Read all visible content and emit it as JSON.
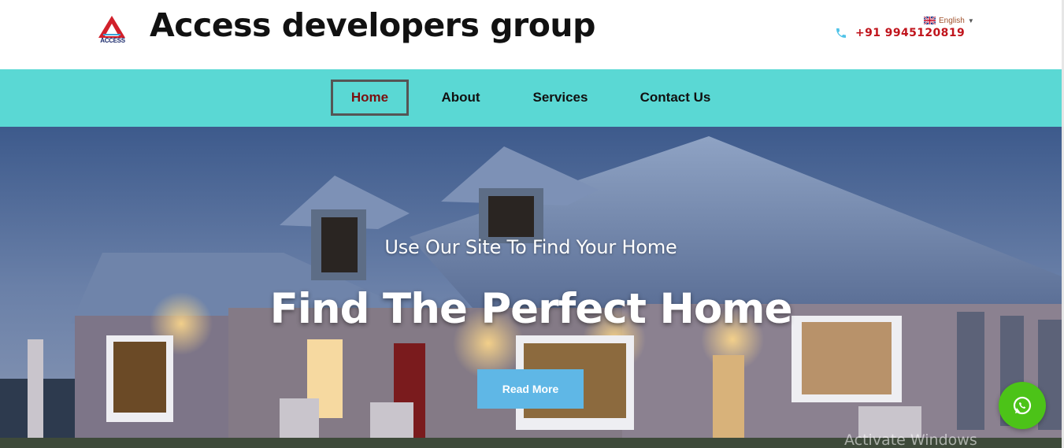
{
  "header": {
    "logo_text": "ACCESS",
    "site_title": "Access developers group",
    "language": {
      "label": "English",
      "flag_icon": "uk-flag-icon"
    },
    "phone": {
      "icon": "phone-icon",
      "number": "+91 9945120819"
    }
  },
  "nav": {
    "items": [
      {
        "label": "Home",
        "active": true
      },
      {
        "label": "About",
        "active": false
      },
      {
        "label": "Services",
        "active": false
      },
      {
        "label": "Contact Us",
        "active": false
      }
    ]
  },
  "hero": {
    "subtitle": "Use Our Site To Find Your Home",
    "title": "Find The Perfect Home",
    "button_label": "Read More"
  },
  "overlay": {
    "activate_text": "Activate Windows"
  },
  "floating": {
    "icon": "whatsapp-icon"
  },
  "colors": {
    "nav_bg": "#5ad8d4",
    "phone_text": "#c0141c",
    "button_bg": "#5fb7e6",
    "whatsapp": "#4cc318",
    "active_nav_text": "#7a1010"
  }
}
